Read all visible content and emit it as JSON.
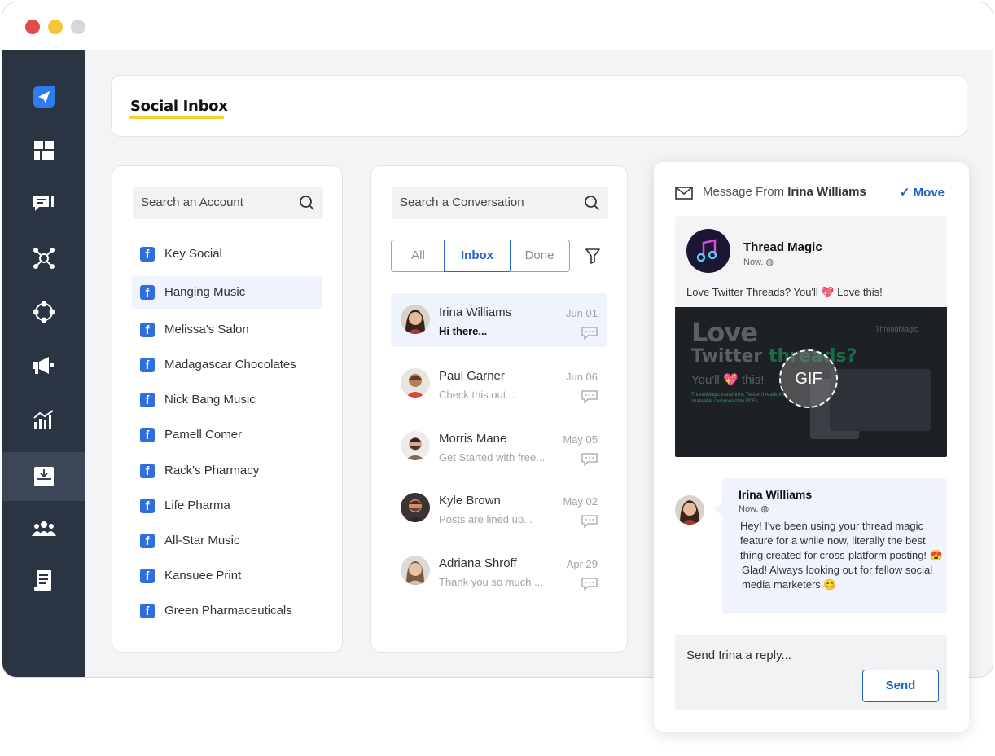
{
  "header": {
    "title": "Social Inbox"
  },
  "accounts": {
    "search_placeholder": "Search an Account",
    "items": [
      "Key Social",
      "Hanging Music",
      "Melissa's Salon",
      "Madagascar Chocolates",
      "Nick Bang Music",
      "Pamell Comer",
      "Rack's Pharmacy",
      "Life Pharma",
      "All-Star Music",
      "Kansuee Print",
      "Green Pharmaceuticals"
    ],
    "selected": "Hanging Music"
  },
  "conversations": {
    "search_placeholder": "Search a Conversation",
    "tabs": {
      "all": "All",
      "inbox": "Inbox",
      "done": "Done"
    },
    "active_tab": "Inbox",
    "items": [
      {
        "name": "Irina Williams",
        "preview": "Hi there...",
        "date": "Jun 01"
      },
      {
        "name": "Paul Garner",
        "preview": "Check this out...",
        "date": "Jun 06"
      },
      {
        "name": "Morris Mane",
        "preview": "Get Started with free...",
        "date": "May 05"
      },
      {
        "name": "Kyle Brown",
        "preview": "Posts are lined up...",
        "date": "May 02"
      },
      {
        "name": "Adriana Shroff",
        "preview": "Thank you so much ...",
        "date": "Apr 29"
      }
    ]
  },
  "message": {
    "header_prefix": "Message From",
    "header_name": "Irina Williams",
    "move_label": "Move",
    "post": {
      "account": "Thread Magic",
      "time": "Now.",
      "text": "Love Twitter Threads? You'll 💖 Love this!",
      "image": {
        "line1": "Love",
        "line2_a": "Twitter",
        "line2_b": "threads?",
        "line3": "You'll 💖 this!",
        "small_text": "ThreadMagic transforms Twitter threads into shareable carousel-style PDFs",
        "brand": "ThreadMagic",
        "gif_label": "GIF"
      }
    },
    "bubble": {
      "name": "Irina Williams",
      "time": "Now.",
      "text": "Hey! I've been using your thread magic feature for a while now, literally the best thing created for cross-platform posting! 😍",
      "reply_text": "Glad! Always looking out for fellow social media marketers 😊"
    },
    "reply_placeholder": "Send Irina a reply...",
    "send_label": "Send"
  },
  "colors": {
    "sidebar": "#2b3443",
    "accent": "#2062c4",
    "underline": "#f6cf2e",
    "facebook": "#2f6ee0"
  }
}
